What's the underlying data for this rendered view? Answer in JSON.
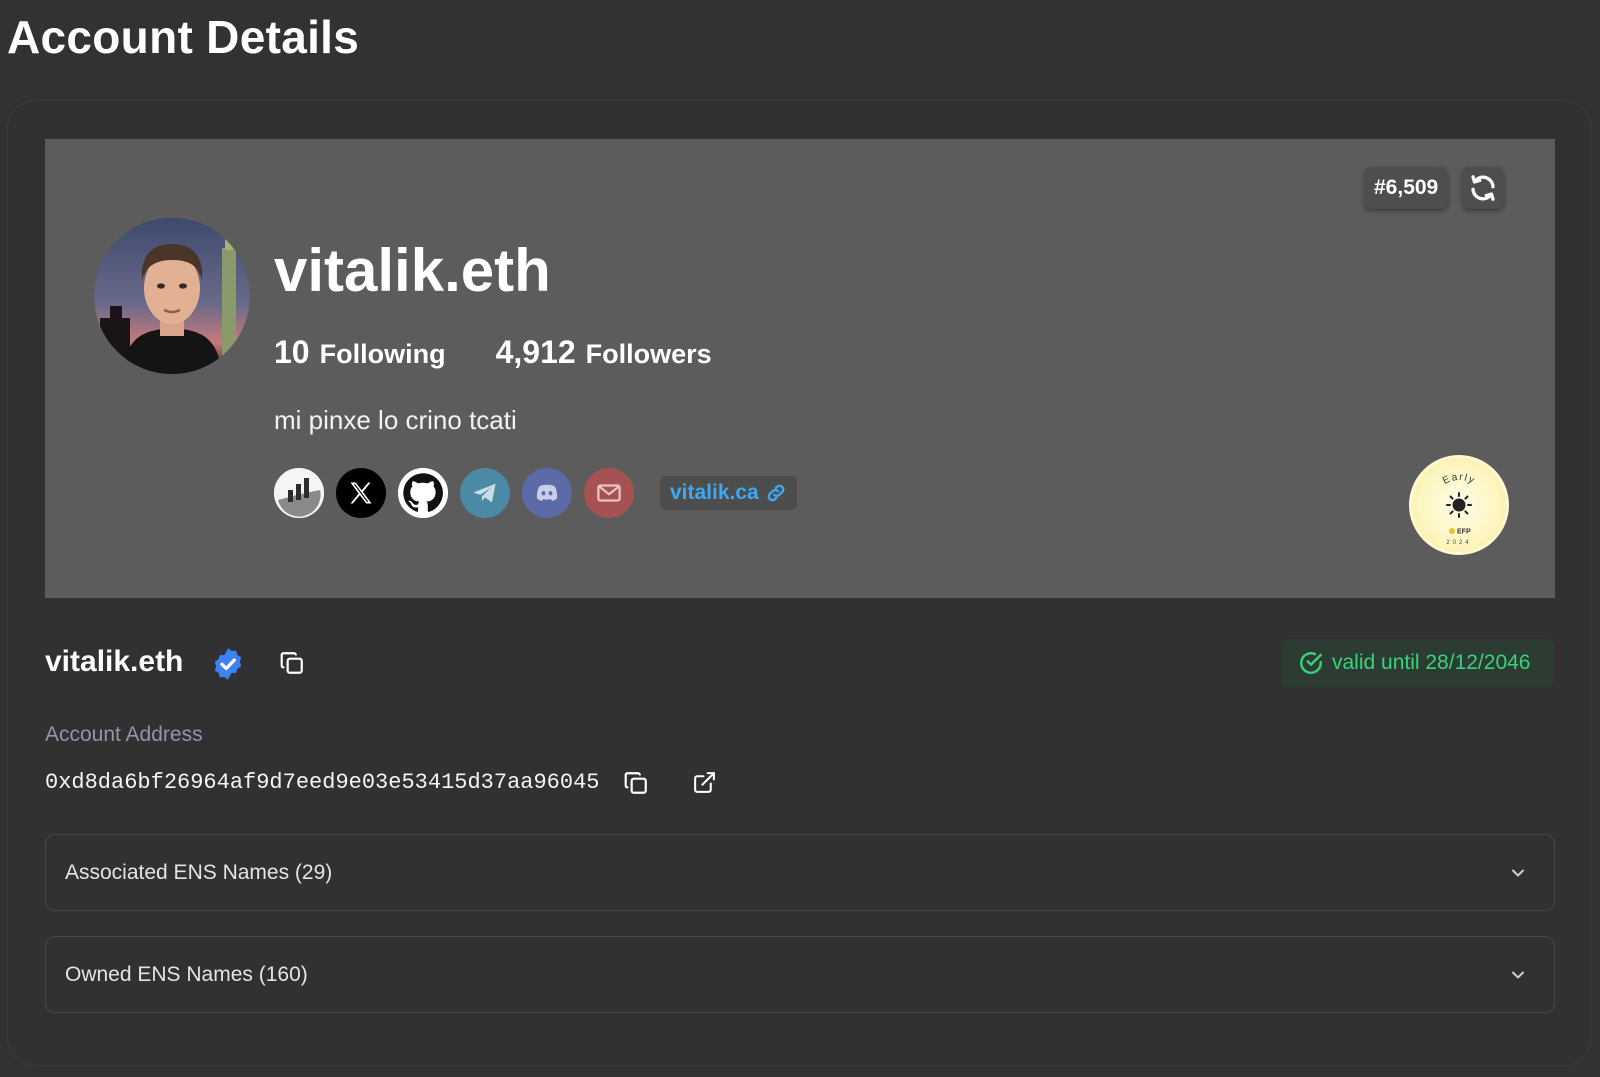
{
  "page": {
    "title": "Account Details"
  },
  "banner": {
    "rank": "#6,509",
    "profile_name": "vitalik.eth",
    "following_count": "10",
    "following_label": "Following",
    "followers_count": "4,912",
    "followers_label": "Followers",
    "bio": "mi pinxe lo crino tcati",
    "socials": [
      "dune",
      "x",
      "github",
      "telegram",
      "discord",
      "email"
    ],
    "website": "vitalik.ca",
    "early_badge": {
      "top_text": "Early",
      "mid_text": "EFP",
      "year": "2024"
    }
  },
  "details": {
    "ens_name": "vitalik.eth",
    "validity": "valid until 28/12/2046",
    "address_label": "Account Address",
    "address": "0xd8da6bf26964af9d7eed9e03e53415d37aa96045"
  },
  "accordions": [
    {
      "label": "Associated ENS Names (29)"
    },
    {
      "label": "Owned ENS Names (160)"
    }
  ],
  "colors": {
    "background": "#323232",
    "banner": "#5b5c5b",
    "link": "#3da9f5",
    "valid": "#38d27a",
    "verified": "#3b82f6"
  }
}
